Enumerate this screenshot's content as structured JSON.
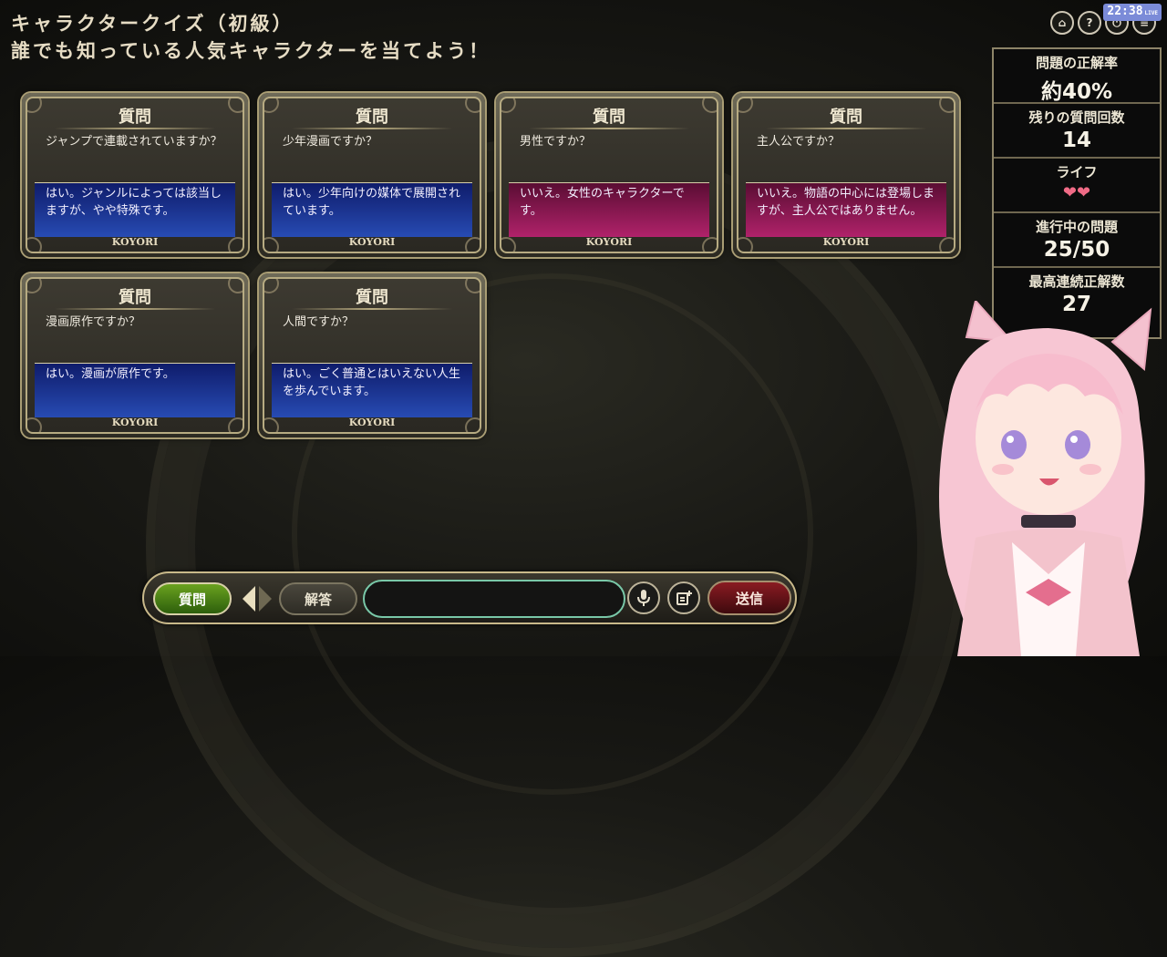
{
  "header": {
    "title": "キャラクタークイズ（初級）",
    "subtitle": "誰でも知っている人気キャラクターを当てよう！",
    "clock": "22:38",
    "clock_badge": "LIVE"
  },
  "top_icons": [
    "home-icon",
    "help-icon",
    "power-icon",
    "menu-icon"
  ],
  "cards": [
    {
      "head": "質問",
      "question": "ジャンプで連載されていますか？",
      "answer": "はい。ジャンルによっては該当しますが、やや特殊です。",
      "result": "yes",
      "footer": "KOYORI"
    },
    {
      "head": "質問",
      "question": "少年漫画ですか？",
      "answer": "はい。少年向けの媒体で展開されています。",
      "result": "yes",
      "footer": "KOYORI"
    },
    {
      "head": "質問",
      "question": "男性ですか？",
      "answer": "いいえ。女性のキャラクターです。",
      "result": "no",
      "footer": "KOYORI"
    },
    {
      "head": "質問",
      "question": "主人公ですか？",
      "answer": "いいえ。物語の中心には登場しますが、主人公ではありません。",
      "result": "no",
      "footer": "KOYORI"
    },
    {
      "head": "質問",
      "question": "漫画原作ですか？",
      "answer": "はい。漫画が原作です。",
      "result": "yes",
      "footer": "KOYORI"
    },
    {
      "head": "質問",
      "question": "人間ですか？",
      "answer": "はい。ごく普通とはいえない人生を歩んでいます。",
      "result": "yes",
      "footer": "KOYORI"
    }
  ],
  "stats": {
    "accuracy_label": "問題の正解率",
    "accuracy_value": "約40%",
    "remaining_label": "残りの質問回数",
    "remaining_value": "14",
    "life_label": "ライフ",
    "life_value": "❤❤",
    "progress_label": "進行中の問題",
    "progress_value": "25/50",
    "streak_label": "最高連続正解数",
    "streak_value": "27"
  },
  "input_bar": {
    "question_button": "質問",
    "answer_button": "解答",
    "input_value": "",
    "send_button": "送信"
  },
  "colors": {
    "yes_answer": "#1f3a9e",
    "no_answer": "#9b1c5b",
    "frame_gold": "#b7ab82"
  }
}
